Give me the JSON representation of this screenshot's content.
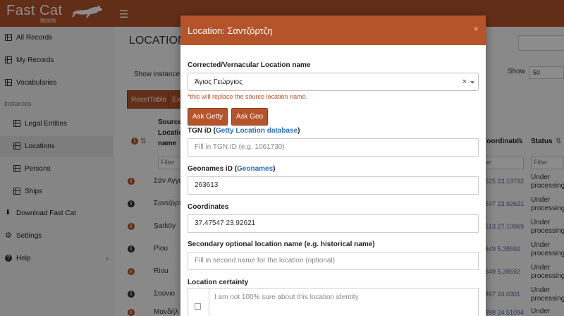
{
  "app": {
    "name": "Fast Cat",
    "team": "team"
  },
  "sidebar": {
    "items": [
      {
        "label": "All Records"
      },
      {
        "label": "My Records"
      },
      {
        "label": "Vocabularies"
      }
    ],
    "section": "Instances",
    "instances": [
      {
        "label": "Legal Entities"
      },
      {
        "label": "Locations"
      },
      {
        "label": "Persons"
      },
      {
        "label": "Ships"
      }
    ],
    "bottom": [
      {
        "label": "Download Fast Cat"
      },
      {
        "label": "Settings"
      },
      {
        "label": "Help"
      }
    ],
    "collapse_glyph": "‹"
  },
  "main": {
    "title": "LOCATION",
    "show_instances": "Show instances",
    "show_label": "Show",
    "show_value": "50",
    "buttons": {
      "reset": "ResetTable",
      "ex": "Ex"
    },
    "headers": {
      "source": "Source\nLocation\nname",
      "coords": "Coordinates",
      "status": "Status"
    },
    "filter_placeholder": "Filter",
    "rows": [
      {
        "source": "Σάν Αγγέ",
        "coords": "525 23.19792",
        "status": "Under processing"
      },
      {
        "source": "Σαντζόρτ",
        "coords": "547 23.92621",
        "status": "Under processing"
      },
      {
        "source": "Şarköy",
        "coords": "513 27.10069",
        "status": "Under processing"
      },
      {
        "source": "Piou",
        "coords": "649 5.38592",
        "status": "Under processing"
      },
      {
        "source": "Riou",
        "coords": "649 5.38592",
        "status": "Under processing"
      },
      {
        "source": "Σούνιο",
        "coords": "897 24.0301",
        "status": "Under processing"
      },
      {
        "source": "Μανδήλ",
        "coords": "998 24.51094",
        "status": "Under processing"
      }
    ]
  },
  "modal": {
    "title": "Location: Σαντζόρτζη",
    "close": "×",
    "corrected_label": "Corrected/Vernacular Location name",
    "corrected_value": "Άγιος Γεώργιος",
    "clear_glyph": "×",
    "hint": "*this will replace the source location name.",
    "ask_getty": "Ask Getty",
    "ask_geo": "Ask Geo",
    "tgn_label": "TGN iD (",
    "tgn_link": "Getty Location database",
    "tgn_close": ")",
    "tgn_placeholder": "Fill in TGN ID (e.g. 1061730)",
    "geonames_label": "Geonames iD (",
    "geonames_link": "Geonames",
    "geonames_close": ")",
    "geonames_value": "263613",
    "coords_label": "Coordinates",
    "coords_value": "37.47547 23.92621",
    "secondary_label": "Secondary optional location name (e.g. historical name)",
    "secondary_placeholder": "Fill in second name for the location (optional)",
    "certainty_label": "Location certainty",
    "certainty_text": "I am not 100% sure about this location identity"
  },
  "colors": {
    "brand": "#b5542a",
    "link": "#2a6fb5"
  }
}
